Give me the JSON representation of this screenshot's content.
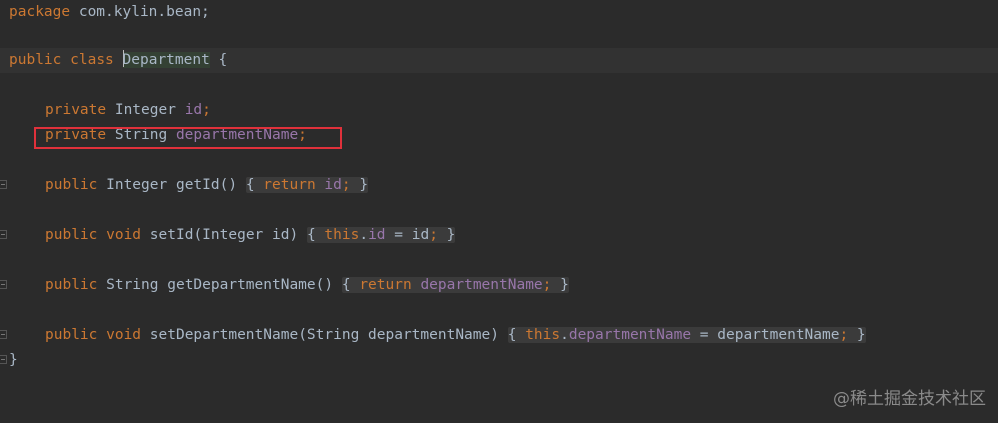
{
  "editor": {
    "line_package": {
      "keyword": "package",
      "rest": " com.kylin.bean;"
    },
    "line_class": {
      "mod": "public",
      "cls": "class",
      "sp": " ",
      "caret_char": "D",
      "name_rest": "epartment",
      "brace": " {"
    },
    "line_id": {
      "kw": "private",
      "type": " Integer ",
      "field": "id",
      "semi": ";"
    },
    "line_dept": {
      "kw": "private",
      "type": " String ",
      "field": "departmentName",
      "semi": ";"
    },
    "line_getId": {
      "kw": "public",
      "type": " Integer ",
      "name": "getId",
      "parens": "()",
      "sp": " ",
      "open": "{ ",
      "ret": "return",
      "sp2": " ",
      "field": "id",
      "semi": ";",
      "close": " }"
    },
    "line_setId": {
      "kw": "public",
      "void": " void ",
      "name": "setId",
      "params": "(Integer id)",
      "sp": " ",
      "open": "{ ",
      "this": "this",
      "dot": ".",
      "field": "id",
      "assign": " = id",
      "semi": ";",
      "close": " }"
    },
    "line_getDept": {
      "kw": "public",
      "type": " String ",
      "name": "getDepartmentName",
      "parens": "()",
      "sp": " ",
      "open": "{ ",
      "ret": "return",
      "sp2": " ",
      "field": "departmentName",
      "semi": ";",
      "close": " }"
    },
    "line_setDept": {
      "kw": "public",
      "void": " void ",
      "name": "setDepartmentName",
      "params": "(String departmentName)",
      "sp": " ",
      "open": "{ ",
      "this": "this",
      "dot": ".",
      "field": "departmentName",
      "assign": " = departmentName",
      "semi": ";",
      "close": " }"
    },
    "line_end": {
      "brace": "}"
    }
  },
  "watermark": "@稀土掘金技术社区",
  "colors": {
    "background": "#2b2b2b",
    "keyword": "#cc7832",
    "field": "#9876aa",
    "text": "#a9b7c6",
    "highlight_box": "#e0313b"
  }
}
